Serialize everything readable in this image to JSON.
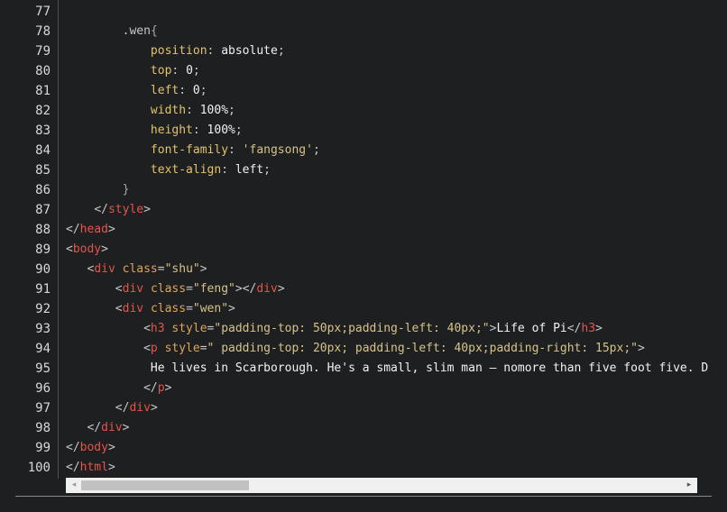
{
  "editor": {
    "lines": [
      {
        "n": "77",
        "indent": "",
        "tokens": []
      },
      {
        "n": "78",
        "indent": "        ",
        "tokens": [
          [
            "sel",
            ".wen"
          ],
          [
            "brace",
            "{"
          ]
        ]
      },
      {
        "n": "79",
        "indent": "            ",
        "tokens": [
          [
            "prop",
            "position"
          ],
          [
            "punc",
            ": "
          ],
          [
            "val",
            "absolute"
          ],
          [
            "punc",
            ";"
          ]
        ]
      },
      {
        "n": "80",
        "indent": "            ",
        "tokens": [
          [
            "prop",
            "top"
          ],
          [
            "punc",
            ": "
          ],
          [
            "val",
            "0"
          ],
          [
            "punc",
            ";"
          ]
        ]
      },
      {
        "n": "81",
        "indent": "            ",
        "tokens": [
          [
            "prop",
            "left"
          ],
          [
            "punc",
            ": "
          ],
          [
            "val",
            "0"
          ],
          [
            "punc",
            ";"
          ]
        ]
      },
      {
        "n": "82",
        "indent": "            ",
        "tokens": [
          [
            "prop",
            "width"
          ],
          [
            "punc",
            ": "
          ],
          [
            "val",
            "100%"
          ],
          [
            "punc",
            ";"
          ]
        ]
      },
      {
        "n": "83",
        "indent": "            ",
        "tokens": [
          [
            "prop",
            "height"
          ],
          [
            "punc",
            ": "
          ],
          [
            "val",
            "100%"
          ],
          [
            "punc",
            ";"
          ]
        ]
      },
      {
        "n": "84",
        "indent": "            ",
        "tokens": [
          [
            "prop",
            "font-family"
          ],
          [
            "punc",
            ": "
          ],
          [
            "str",
            "'fangsong'"
          ],
          [
            "punc",
            ";"
          ]
        ]
      },
      {
        "n": "85",
        "indent": "            ",
        "tokens": [
          [
            "prop",
            "text-align"
          ],
          [
            "punc",
            ": "
          ],
          [
            "val",
            "left"
          ],
          [
            "punc",
            ";"
          ]
        ]
      },
      {
        "n": "86",
        "indent": "        ",
        "tokens": [
          [
            "brace",
            "}"
          ]
        ]
      },
      {
        "n": "87",
        "indent": "    ",
        "tokens": [
          [
            "punc",
            "</"
          ],
          [
            "tag",
            "style"
          ],
          [
            "punc",
            ">"
          ]
        ]
      },
      {
        "n": "88",
        "indent": "",
        "tokens": [
          [
            "punc",
            "</"
          ],
          [
            "tag",
            "head"
          ],
          [
            "punc",
            ">"
          ]
        ]
      },
      {
        "n": "89",
        "indent": "",
        "tokens": [
          [
            "punc",
            "<"
          ],
          [
            "tag",
            "body"
          ],
          [
            "punc",
            ">"
          ]
        ]
      },
      {
        "n": "90",
        "indent": "   ",
        "tokens": [
          [
            "punc",
            "<"
          ],
          [
            "tag",
            "div"
          ],
          [
            "punc",
            " "
          ],
          [
            "attr",
            "class"
          ],
          [
            "punc",
            "="
          ],
          [
            "str",
            "\"shu\""
          ],
          [
            "punc",
            ">"
          ]
        ]
      },
      {
        "n": "91",
        "indent": "       ",
        "tokens": [
          [
            "punc",
            "<"
          ],
          [
            "tag",
            "div"
          ],
          [
            "punc",
            " "
          ],
          [
            "attr",
            "class"
          ],
          [
            "punc",
            "="
          ],
          [
            "str",
            "\"feng\""
          ],
          [
            "punc",
            "></"
          ],
          [
            "tag",
            "div"
          ],
          [
            "punc",
            ">"
          ]
        ]
      },
      {
        "n": "92",
        "indent": "       ",
        "tokens": [
          [
            "punc",
            "<"
          ],
          [
            "tag",
            "div"
          ],
          [
            "punc",
            " "
          ],
          [
            "attr",
            "class"
          ],
          [
            "punc",
            "="
          ],
          [
            "str",
            "\"wen\""
          ],
          [
            "punc",
            ">"
          ]
        ]
      },
      {
        "n": "93",
        "indent": "           ",
        "tokens": [
          [
            "punc",
            "<"
          ],
          [
            "tag",
            "h3"
          ],
          [
            "punc",
            " "
          ],
          [
            "attr",
            "style"
          ],
          [
            "punc",
            "="
          ],
          [
            "str",
            "\"padding-top: 50px;padding-left: 40px;\""
          ],
          [
            "punc",
            ">"
          ],
          [
            "text",
            "Life of Pi"
          ],
          [
            "punc",
            "</"
          ],
          [
            "tag",
            "h3"
          ],
          [
            "punc",
            ">"
          ]
        ]
      },
      {
        "n": "94",
        "indent": "           ",
        "tokens": [
          [
            "punc",
            "<"
          ],
          [
            "tag",
            "p"
          ],
          [
            "punc",
            " "
          ],
          [
            "attr",
            "style"
          ],
          [
            "punc",
            "="
          ],
          [
            "str",
            "\" padding-top: 20px; padding-left: 40px;padding-right: 15px;\""
          ],
          [
            "punc",
            ">"
          ]
        ]
      },
      {
        "n": "95",
        "indent": "            ",
        "tokens": [
          [
            "text",
            "He lives in Scarborough. He's a small, slim man – nomore than five foot five. D"
          ]
        ]
      },
      {
        "n": "96",
        "indent": "           ",
        "tokens": [
          [
            "punc",
            "</"
          ],
          [
            "tag",
            "p"
          ],
          [
            "punc",
            ">"
          ]
        ]
      },
      {
        "n": "97",
        "indent": "       ",
        "tokens": [
          [
            "punc",
            "</"
          ],
          [
            "tag",
            "div"
          ],
          [
            "punc",
            ">"
          ]
        ]
      },
      {
        "n": "98",
        "indent": "   ",
        "tokens": [
          [
            "punc",
            "</"
          ],
          [
            "tag",
            "div"
          ],
          [
            "punc",
            ">"
          ]
        ]
      },
      {
        "n": "99",
        "indent": "",
        "tokens": [
          [
            "punc",
            "</"
          ],
          [
            "tag",
            "body"
          ],
          [
            "punc",
            ">"
          ]
        ]
      },
      {
        "n": "100",
        "indent": "",
        "tokens": [
          [
            "punc",
            "</"
          ],
          [
            "tag",
            "html"
          ],
          [
            "punc",
            ">"
          ]
        ]
      }
    ]
  },
  "scrollbar": {
    "left_arrow": "◂",
    "right_arrow": "▸",
    "thumb_fraction": 0.28
  },
  "colors": {
    "background": "#1d1f21",
    "tag": "#e5534b",
    "string": "#d7c28a",
    "property": "#e3c26e"
  }
}
